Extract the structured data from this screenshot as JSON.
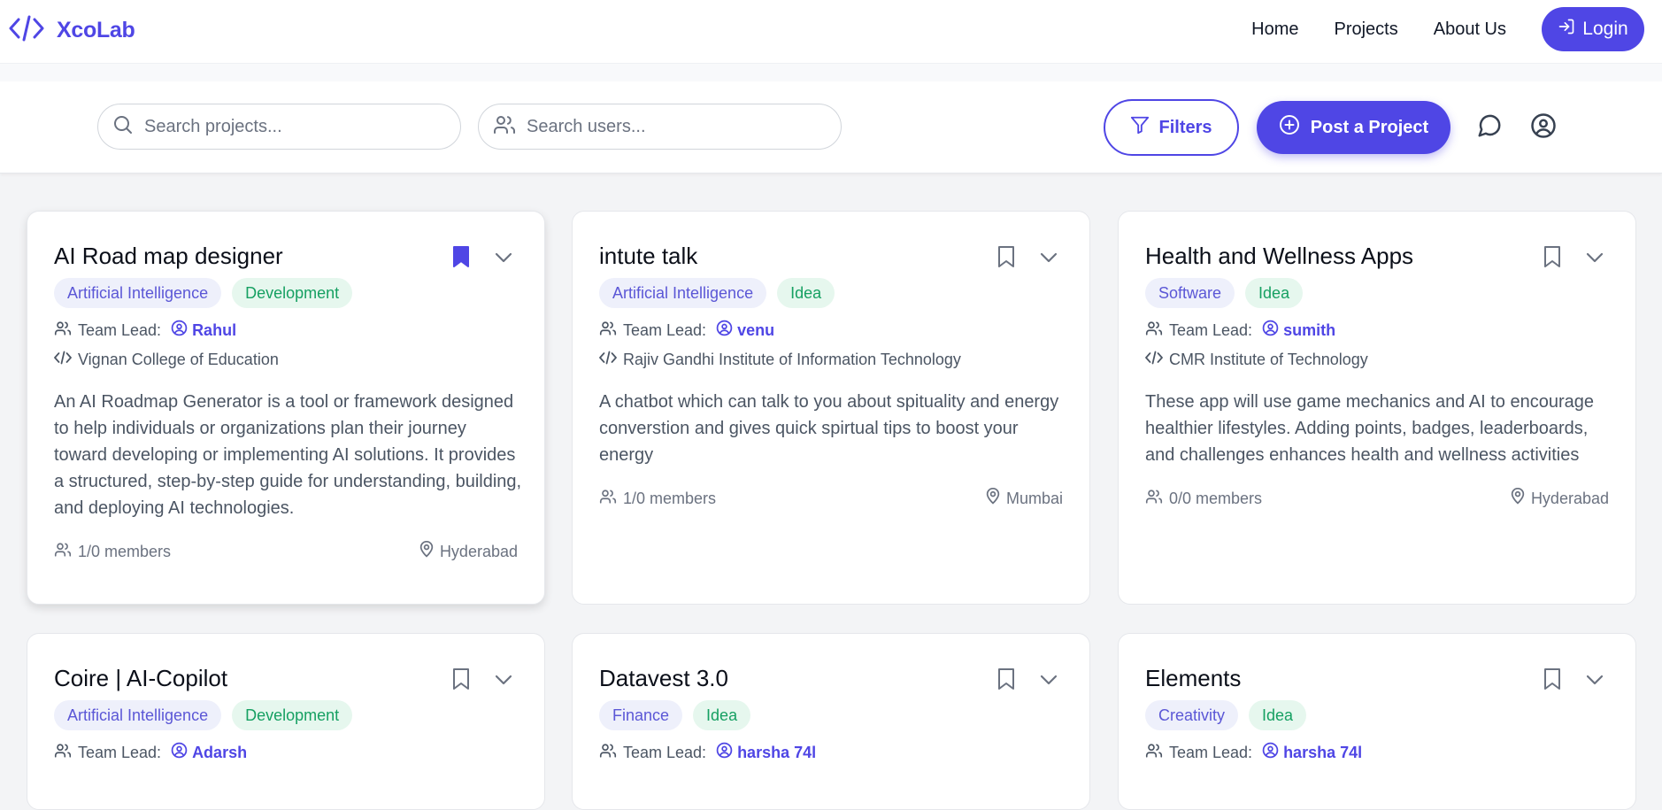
{
  "nav": {
    "brand": "XcoLab",
    "links": [
      "Home",
      "Projects",
      "About Us"
    ],
    "login_label": "Login"
  },
  "toolbar": {
    "search_projects_placeholder": "Search projects...",
    "search_users_placeholder": "Search users...",
    "filters_label": "Filters",
    "post_label": "Post a Project"
  },
  "colors": {
    "accent": "#4f46e5",
    "category_tag_bg": "#eef0fb",
    "stage_tag_bg": "#e6f7ee",
    "stage_tag_text": "#16a062"
  },
  "team_lead_label": "Team Lead:",
  "cards": [
    {
      "title": "AI Road map designer",
      "bookmarked": true,
      "category": "Artificial Intelligence",
      "stage": "Development",
      "lead": "Rahul",
      "institute": "Vignan College of Education",
      "description": "An AI Roadmap Generator is a tool or framework designed to help individuals or organizations plan their journey toward developing or implementing AI solutions. It provides a structured, step-by-step guide for understanding, building, and deploying AI technologies.",
      "members": "1/0 members",
      "location": "Hyderabad"
    },
    {
      "title": "intute talk",
      "bookmarked": false,
      "category": "Artificial Intelligence",
      "stage": "Idea",
      "lead": "venu",
      "institute": "Rajiv Gandhi Institute of Information Technology",
      "description": "A chatbot which can talk to you about spituality and energy converstion and gives quick spirtual tips to boost your energy",
      "members": "1/0 members",
      "location": "Mumbai"
    },
    {
      "title": "Health and Wellness Apps",
      "bookmarked": false,
      "category": "Software",
      "stage": "Idea",
      "lead": "sumith",
      "institute": "CMR Institute of Technology",
      "description": "These app will use game mechanics and AI to encourage healthier lifestyles. Adding points, badges, leaderboards, and challenges enhances health and wellness activities",
      "members": "0/0 members",
      "location": "Hyderabad"
    },
    {
      "title": "Coire | AI-Copilot",
      "bookmarked": false,
      "category": "Artificial Intelligence",
      "stage": "Development",
      "lead": "Adarsh"
    },
    {
      "title": "Datavest 3.0",
      "bookmarked": false,
      "category": "Finance",
      "stage": "Idea",
      "lead": "harsha 74l"
    },
    {
      "title": "Elements",
      "bookmarked": false,
      "category": "Creativity",
      "stage": "Idea",
      "lead": "harsha 74l"
    }
  ]
}
